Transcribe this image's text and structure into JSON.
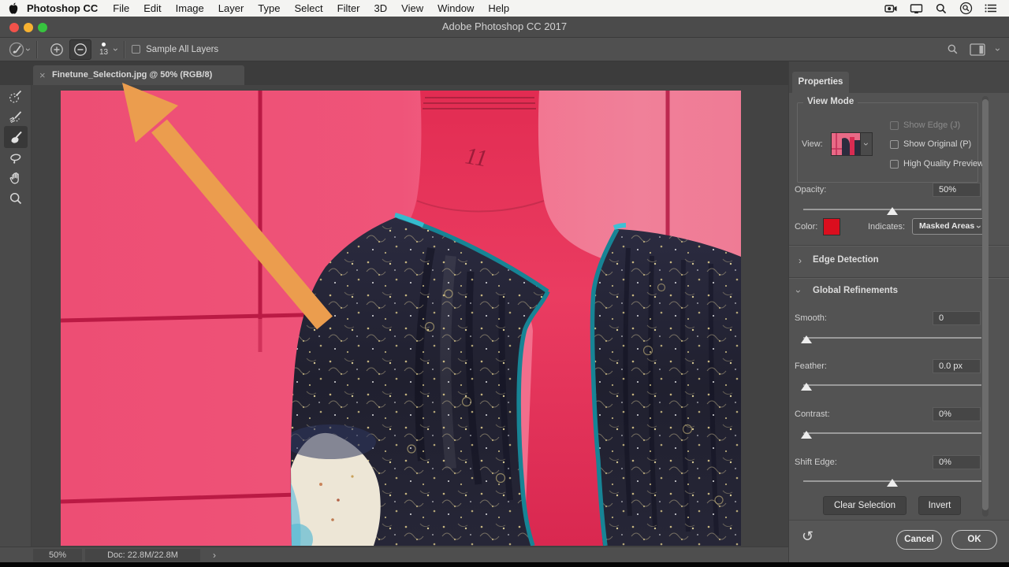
{
  "menu_bar": {
    "app_name": "Photoshop CC",
    "items": [
      "File",
      "Edit",
      "Image",
      "Layer",
      "Type",
      "Select",
      "Filter",
      "3D",
      "View",
      "Window",
      "Help"
    ]
  },
  "title_bar": {
    "title": "Adobe Photoshop CC 2017"
  },
  "options_bar": {
    "brush_size": "13",
    "sample_all_layers_label": "Sample All Layers"
  },
  "document_tab": {
    "label": "Finetune_Selection.jpg @ 50% (RGB/8)"
  },
  "canvas": {
    "mannequin_mark": "11"
  },
  "properties_panel": {
    "tab_label": "Properties",
    "view_mode": {
      "legend": "View Mode",
      "view_label": "View:",
      "show_edge": "Show Edge (J)",
      "show_original": "Show Original (P)",
      "high_quality": "High Quality Preview"
    },
    "opacity_label": "Opacity:",
    "opacity_value": "50%",
    "color_label": "Color:",
    "indicates_label": "Indicates:",
    "indicates_value": "Masked Areas",
    "edge_detection_label": "Edge Detection",
    "global_refinements_label": "Global Refinements",
    "sliders": [
      {
        "label": "Smooth:",
        "value": "0"
      },
      {
        "label": "Feather:",
        "value": "0.0 px"
      },
      {
        "label": "Contrast:",
        "value": "0%"
      },
      {
        "label": "Shift Edge:",
        "value": "0%"
      }
    ],
    "clear_selection_label": "Clear Selection",
    "invert_label": "Invert",
    "cancel_label": "Cancel",
    "ok_label": "OK"
  },
  "status_bar": {
    "zoom": "50%",
    "doc_info": "Doc: 22.8M/22.8M"
  },
  "icons": {
    "chevron": "›",
    "close": "×",
    "reset": "↺"
  },
  "colors": {
    "overlay_pink": "#EF5379",
    "window_grid_red": "#B5153F",
    "mannequin_red": "#E23053",
    "color_swatch_red": "#DB0E1E",
    "teal_trim": "#178495",
    "arrow_orange": "#EB9D4E"
  }
}
